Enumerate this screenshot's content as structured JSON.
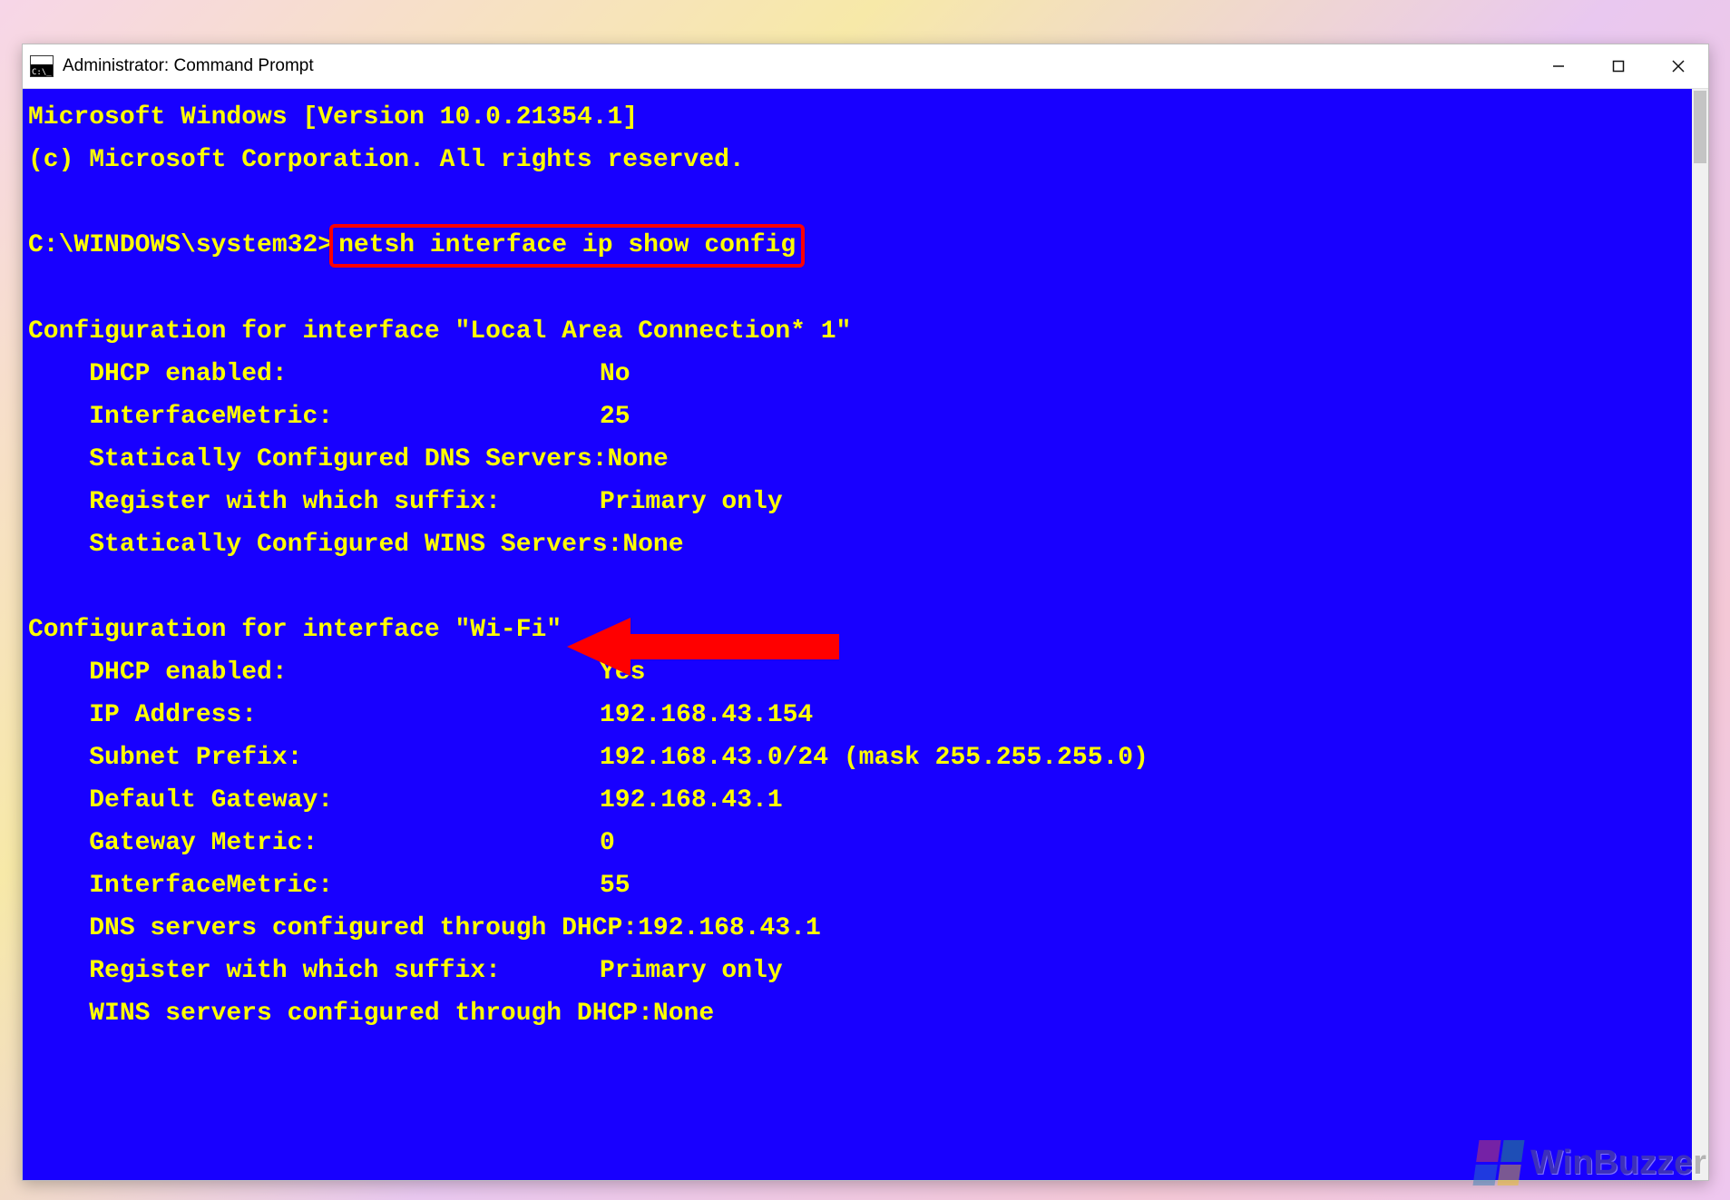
{
  "titlebar": {
    "title": "Administrator: Command Prompt"
  },
  "terminal": {
    "banner_line1": "Microsoft Windows [Version 10.0.21354.1]",
    "banner_line2": "(c) Microsoft Corporation. All rights reserved.",
    "prompt_path": "C:\\WINDOWS\\system32>",
    "command": "netsh interface ip show config",
    "sections": [
      {
        "header": "Configuration for interface \"Local Area Connection* 1\"",
        "rows": [
          {
            "label": "DHCP enabled:",
            "value": "No"
          },
          {
            "label": "InterfaceMetric:",
            "value": "25"
          },
          {
            "label": "Statically Configured DNS Servers:",
            "value": "None"
          },
          {
            "label": "Register with which suffix:",
            "value": "Primary only"
          },
          {
            "label": "Statically Configured WINS Servers:",
            "value": "None"
          }
        ]
      },
      {
        "header": "Configuration for interface \"Wi-Fi\"",
        "rows": [
          {
            "label": "DHCP enabled:",
            "value": "Yes"
          },
          {
            "label": "IP Address:",
            "value": "192.168.43.154"
          },
          {
            "label": "Subnet Prefix:",
            "value": "192.168.43.0/24 (mask 255.255.255.0)"
          },
          {
            "label": "Default Gateway:",
            "value": "192.168.43.1"
          },
          {
            "label": "Gateway Metric:",
            "value": "0"
          },
          {
            "label": "InterfaceMetric:",
            "value": "55"
          },
          {
            "label": "DNS servers configured through DHCP:",
            "value": "192.168.43.1"
          },
          {
            "label": "Register with which suffix:",
            "value": "Primary only"
          },
          {
            "label": "WINS servers configured through DHCP:",
            "value": "None"
          }
        ]
      }
    ]
  },
  "annotations": {
    "highlight": "command",
    "arrow_points_to": "Wi-Fi section header"
  },
  "watermark": "WinBuzzer"
}
